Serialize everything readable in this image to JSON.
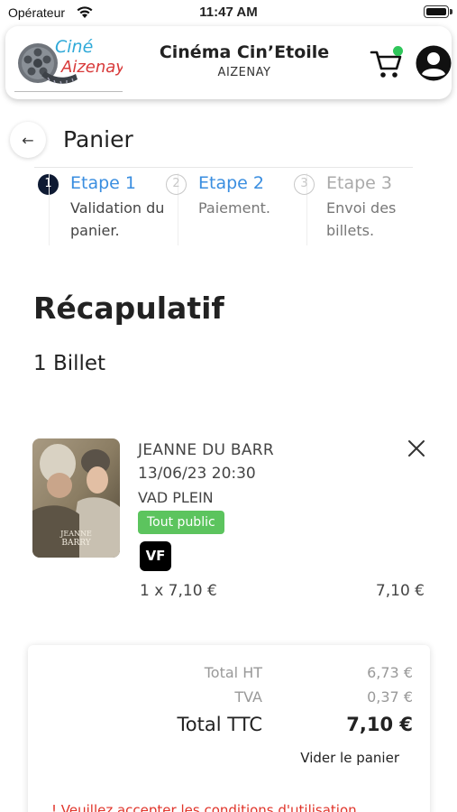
{
  "status_bar": {
    "carrier": "Opérateur",
    "time": "11:47 AM"
  },
  "header": {
    "logo_text_line1": "Ciné",
    "logo_text_line2": "Aizenay",
    "cinema_name": "Cinéma Cin’Etoile",
    "cinema_city": "AIZENAY",
    "cart_icon": "cart-icon",
    "cart_indicator_color": "#2fc65a",
    "account_icon": "account-icon"
  },
  "page": {
    "back_icon": "←",
    "title": "Panier"
  },
  "steps": [
    {
      "number": "1",
      "title": "Etape 1",
      "description": "Validation du panier.",
      "state": "active"
    },
    {
      "number": "2",
      "title": "Etape 2",
      "description": "Paiement.",
      "state": "upcoming"
    },
    {
      "number": "3",
      "title": "Etape 3",
      "description": "Envoi des billets.",
      "state": "disabled"
    }
  ],
  "summary": {
    "title": "Récapulatif",
    "ticket_count": "1 Billet"
  },
  "ticket": {
    "poster_title_line1": "JEANNE",
    "poster_title_line2": "BARRY",
    "movie_title": "JEANNE DU BARR",
    "datetime": "13/06/23 20:30",
    "price_label": "VAD PLEIN",
    "age_rating": "Tout public",
    "version": "VF",
    "quantity_price": "1 x 7,10 €",
    "line_total": "7,10 €",
    "age_badge_color": "#5cc45e"
  },
  "totals": {
    "ht_label": "Total HT",
    "ht_value": "6,73 €",
    "tva_label": "TVA",
    "tva_value": "0,37 €",
    "ttc_label": "Total TTC",
    "ttc_value": "7,10 €",
    "empty_cart_label": "Vider le panier",
    "conditions_warning": "! Veuillez accepter les conditions d'utilisation"
  },
  "colors": {
    "accent_blue": "#3a8ee0",
    "active_step": "#0e1a33",
    "warning_red": "#e0342a"
  }
}
